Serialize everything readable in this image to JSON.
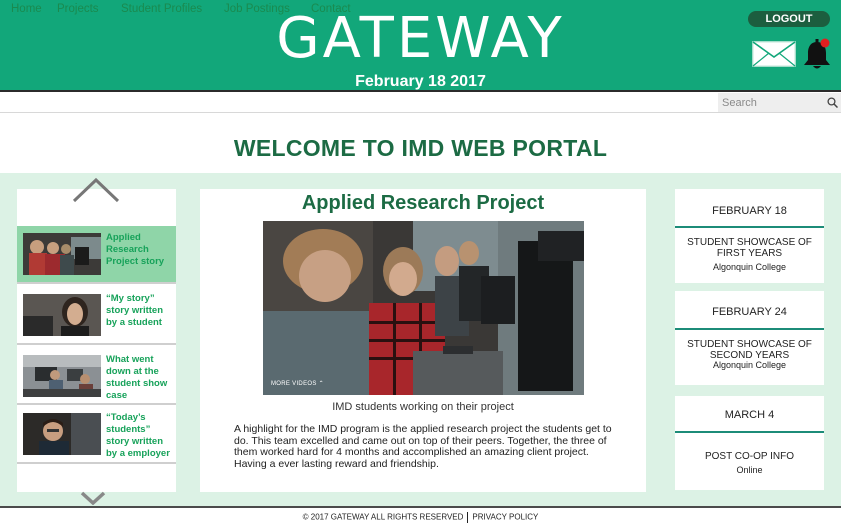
{
  "header": {
    "brand": "GATEWAY",
    "date": "February 18 2017",
    "logout_label": "LOGOUT",
    "mail_icon": "envelope-icon",
    "bell_icon": "bell-icon",
    "accent": "#12a77a",
    "notification_color": "#e02020"
  },
  "nav": {
    "items": [
      {
        "label": "Home"
      },
      {
        "label": "Projects"
      },
      {
        "label": "Student Profiles"
      },
      {
        "label": "Job Postings"
      },
      {
        "label": "Contact"
      }
    ],
    "search_placeholder": "Search"
  },
  "welcome": "WELCOME TO IMD WEB PORTAL",
  "stories": [
    {
      "label": "Applied Research Project story",
      "active": true
    },
    {
      "label": "“My story” story written by a student",
      "active": false
    },
    {
      "label": "What went down at the student show case",
      "active": false
    },
    {
      "label": "“Today’s students” story written by a employer",
      "active": false
    }
  ],
  "main": {
    "title": "Applied Research Project",
    "video_overlay": "MORE VIDEOS ⌃",
    "caption": "IMD students working on their project",
    "paragraph": "A highlight for the IMD program is the applied research project the students get to do. This team excelled and came out on top of their peers. Together, the three of them worked hard for 4 months and accomplished an amazing client project. Having a ever lasting reward and friendship."
  },
  "events": [
    {
      "date": "FEBRUARY 18",
      "title": "STUDENT SHOWCASE OF FIRST YEARS",
      "location": "Algonquin College"
    },
    {
      "date": "FEBRUARY 24",
      "title": "STUDENT SHOWCASE OF SECOND YEARS",
      "location": "Algonquin College"
    },
    {
      "date": "MARCH 4",
      "title": "POST CO-OP INFO",
      "location": "Online"
    }
  ],
  "footer": {
    "copyright": "© 2017 GATEWAY ALL RIGHTS RESERVED",
    "privacy": "PRIVACY POLICY"
  }
}
